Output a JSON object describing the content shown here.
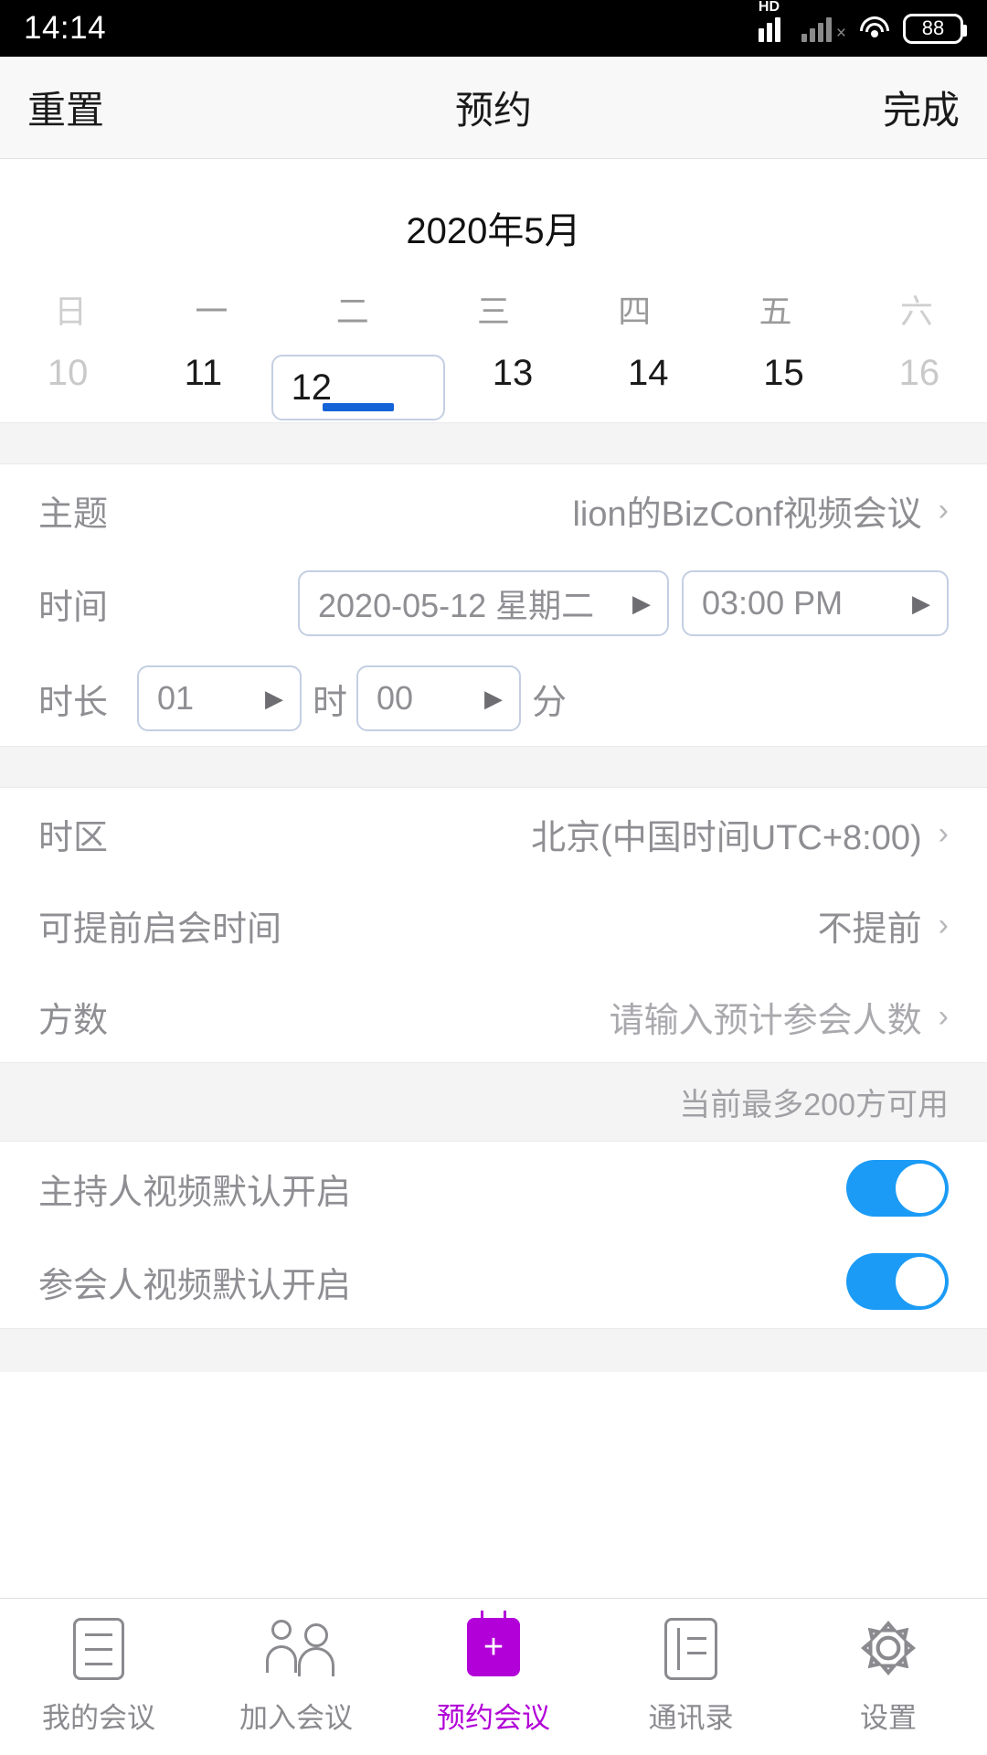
{
  "status_bar": {
    "time": "14:14",
    "hd_label": "HD",
    "battery_level": "88",
    "icons": [
      "signal-icon",
      "signal-dim-icon",
      "wifi-icon",
      "battery-icon"
    ]
  },
  "nav_bar": {
    "left_label": "重置",
    "title": "预约",
    "right_label": "完成"
  },
  "calendar": {
    "month_label": "2020年5月",
    "weekdays": [
      {
        "label": "日",
        "dim": true
      },
      {
        "label": "一",
        "dim": false
      },
      {
        "label": "二",
        "dim": false
      },
      {
        "label": "三",
        "dim": false
      },
      {
        "label": "四",
        "dim": false
      },
      {
        "label": "五",
        "dim": false
      },
      {
        "label": "六",
        "dim": true
      }
    ],
    "days": [
      {
        "num": "10",
        "dim": true,
        "selected": false
      },
      {
        "num": "11",
        "dim": false,
        "selected": false
      },
      {
        "num": "12",
        "dim": false,
        "selected": true
      },
      {
        "num": "13",
        "dim": false,
        "selected": false
      },
      {
        "num": "14",
        "dim": false,
        "selected": false
      },
      {
        "num": "15",
        "dim": false,
        "selected": false
      },
      {
        "num": "16",
        "dim": true,
        "selected": false
      }
    ],
    "selected_accent": "#1464d7"
  },
  "form": {
    "topic": {
      "label": "主题",
      "value": "lion的BizConf视频会议"
    },
    "time": {
      "label": "时间",
      "date_value": "2020-05-12 星期二",
      "clock_value": "03:00 PM"
    },
    "duration": {
      "label": "时长",
      "hours_value": "01",
      "hours_unit": "时",
      "minutes_value": "00",
      "minutes_unit": "分"
    },
    "timezone": {
      "label": "时区",
      "value": "北京(中国时间UTC+8:00)"
    },
    "early_start": {
      "label": "可提前启会时间",
      "value": "不提前"
    },
    "party_count": {
      "label": "方数",
      "placeholder": "请输入预计参会人数"
    },
    "capacity_hint": "当前最多200方可用",
    "host_video": {
      "label": "主持人视频默认开启",
      "on": true
    },
    "attendee_video": {
      "label": "参会人视频默认开启",
      "on": true
    },
    "switch_on_color": "#1b9bf5"
  },
  "tab_bar": {
    "active_color": "#b200d8",
    "inactive_color": "#8a8a8f",
    "tabs": [
      {
        "label": "我的会议",
        "icon": "document-icon",
        "active": false
      },
      {
        "label": "加入会议",
        "icon": "people-icon",
        "active": false
      },
      {
        "label": "预约会议",
        "icon": "calendar-plus-icon",
        "active": true
      },
      {
        "label": "通讯录",
        "icon": "contacts-book-icon",
        "active": false
      },
      {
        "label": "设置",
        "icon": "gear-icon",
        "active": false
      }
    ]
  }
}
